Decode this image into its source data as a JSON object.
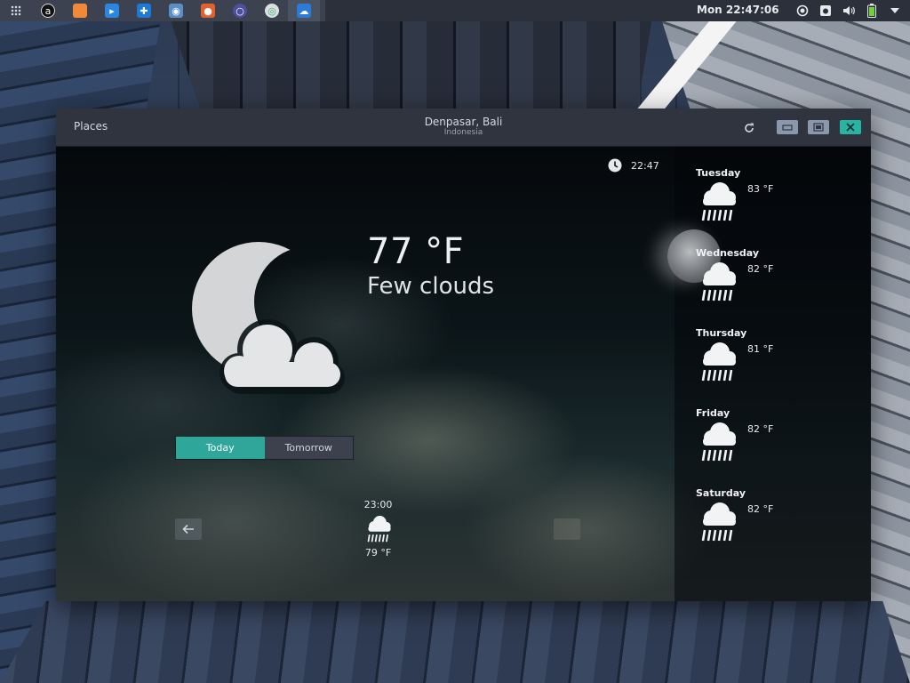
{
  "panel": {
    "clock": "Mon 22:47:06",
    "apps": [
      {
        "name": "activities-grid-icon",
        "color": "#3c4250"
      },
      {
        "name": "amazon-icon",
        "color": "#111111",
        "glyph": "a"
      },
      {
        "name": "files-icon",
        "color": "#f08a3a",
        "glyph": ""
      },
      {
        "name": "screen-recorder-icon",
        "color": "#2a86e0",
        "glyph": "▸"
      },
      {
        "name": "app-store-icon",
        "color": "#1c79d8",
        "glyph": "✚"
      },
      {
        "name": "camera-icon",
        "color": "#5a8ec7",
        "glyph": "◉"
      },
      {
        "name": "firefox-icon",
        "color": "#e2622d",
        "glyph": "●"
      },
      {
        "name": "browser-icon",
        "color": "#4b4f9c",
        "glyph": "○"
      },
      {
        "name": "chrome-icon",
        "color": "#dedede",
        "glyph": "◎"
      },
      {
        "name": "weather-app-icon",
        "color": "#2c7bd6",
        "glyph": "☁"
      }
    ],
    "tray": [
      "record-icon",
      "screenshot-icon",
      "volume-icon",
      "battery-icon",
      "menu-arrow-icon"
    ]
  },
  "window": {
    "places_label": "Places",
    "title": "Denpasar, Bali",
    "subtitle": "Indonesia",
    "accent_color": "#2ea69a"
  },
  "current": {
    "time": "22:47",
    "temperature": "77 °F",
    "condition": "Few clouds",
    "icon": "moon-cloud-icon"
  },
  "switcher": {
    "today_label": "Today",
    "tomorrow_label": "Tomorrow"
  },
  "hourly": [
    {
      "time": "23:00",
      "temp": "79 °F",
      "icon": "rain-icon"
    }
  ],
  "forecast": [
    {
      "day": "Tuesday",
      "temp": "83 °F",
      "icon": "rain-icon"
    },
    {
      "day": "Wednesday",
      "temp": "82 °F",
      "icon": "rain-icon"
    },
    {
      "day": "Thursday",
      "temp": "81 °F",
      "icon": "rain-icon"
    },
    {
      "day": "Friday",
      "temp": "82 °F",
      "icon": "rain-icon"
    },
    {
      "day": "Saturday",
      "temp": "82 °F",
      "icon": "rain-icon"
    }
  ]
}
